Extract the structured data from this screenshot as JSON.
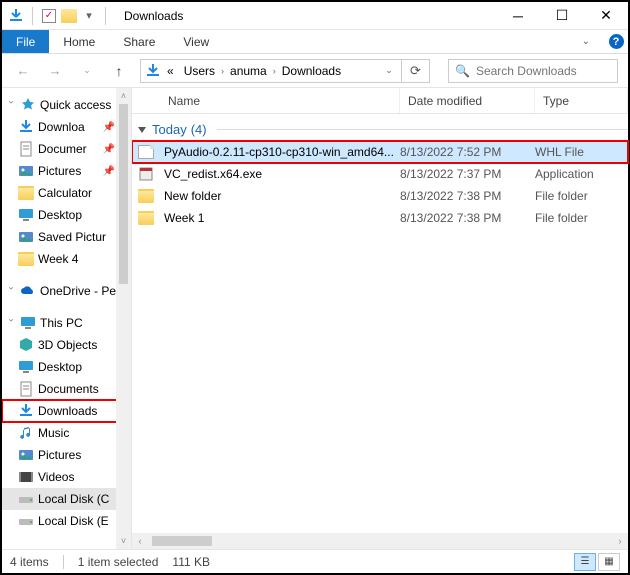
{
  "titlebar": {
    "title": "Downloads"
  },
  "tabs": {
    "file": "File",
    "home": "Home",
    "share": "Share",
    "view": "View"
  },
  "address": {
    "crumbs": [
      "Users",
      "anuma",
      "Downloads"
    ],
    "refresh_glyph": "⟳"
  },
  "search": {
    "placeholder": "Search Downloads"
  },
  "columns": {
    "name": "Name",
    "date": "Date modified",
    "type": "Type"
  },
  "group": {
    "label": "Today",
    "count": "(4)"
  },
  "files": [
    {
      "icon": "file",
      "name": "PyAudio-0.2.11-cp310-cp310-win_amd64...",
      "date": "8/13/2022 7:52 PM",
      "type": "WHL File",
      "selected": true,
      "boxed": true
    },
    {
      "icon": "exe",
      "name": "VC_redist.x64.exe",
      "date": "8/13/2022 7:37 PM",
      "type": "Application",
      "selected": false,
      "boxed": false
    },
    {
      "icon": "folder",
      "name": "New folder",
      "date": "8/13/2022 7:38 PM",
      "type": "File folder",
      "selected": false,
      "boxed": false
    },
    {
      "icon": "folder",
      "name": "Week 1",
      "date": "8/13/2022 7:38 PM",
      "type": "File folder",
      "selected": false,
      "boxed": false
    }
  ],
  "sidebar": {
    "quick_access": "Quick access",
    "quick_items": [
      {
        "icon": "download",
        "label": "Downloa",
        "pin": true
      },
      {
        "icon": "doc",
        "label": "Documer",
        "pin": true
      },
      {
        "icon": "pic",
        "label": "Pictures",
        "pin": true
      },
      {
        "icon": "folder",
        "label": "Calculator",
        "pin": false
      },
      {
        "icon": "desktop",
        "label": "Desktop",
        "pin": false
      },
      {
        "icon": "pic",
        "label": "Saved Pictur",
        "pin": false
      },
      {
        "icon": "folder",
        "label": "Week 4",
        "pin": false
      }
    ],
    "onedrive": "OneDrive - Pe",
    "thispc": "This PC",
    "pc_items": [
      {
        "icon": "3d",
        "label": "3D Objects"
      },
      {
        "icon": "desktop",
        "label": "Desktop"
      },
      {
        "icon": "doc",
        "label": "Documents"
      },
      {
        "icon": "download",
        "label": "Downloads",
        "boxed": true
      },
      {
        "icon": "music",
        "label": "Music"
      },
      {
        "icon": "pic",
        "label": "Pictures"
      },
      {
        "icon": "video",
        "label": "Videos"
      },
      {
        "icon": "drive",
        "label": "Local Disk (C",
        "highlighted": true
      },
      {
        "icon": "drive",
        "label": "Local Disk (E"
      }
    ]
  },
  "status": {
    "items": "4 items",
    "selected": "1 item selected",
    "size": "111 KB"
  }
}
